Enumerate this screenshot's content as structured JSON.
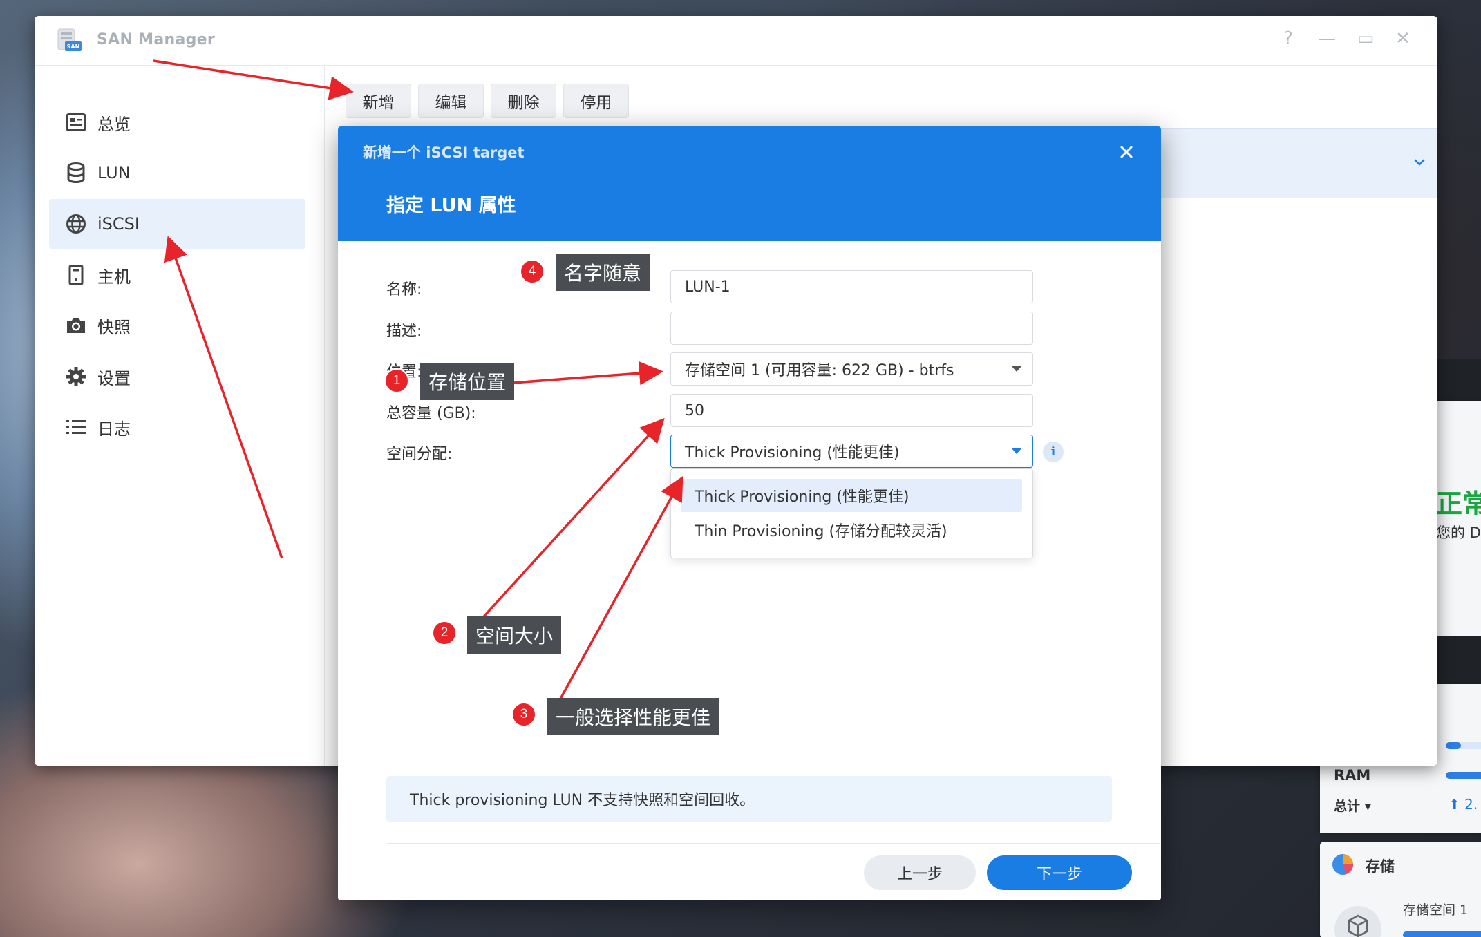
{
  "app": {
    "title": "SAN Manager",
    "logo_text": "SAN",
    "help": "?",
    "minimize": "—",
    "maximize": "▭",
    "close": "✕"
  },
  "sidebar": {
    "items": [
      {
        "label": "总览",
        "icon": "overview-icon"
      },
      {
        "label": "LUN",
        "icon": "database-icon"
      },
      {
        "label": "iSCSI",
        "icon": "globe-icon",
        "active": true
      },
      {
        "label": "主机",
        "icon": "host-icon"
      },
      {
        "label": "快照",
        "icon": "camera-icon"
      },
      {
        "label": "设置",
        "icon": "gear-icon"
      },
      {
        "label": "日志",
        "icon": "list-icon"
      }
    ]
  },
  "toolbar": {
    "add": "新增",
    "edit": "编辑",
    "delete": "删除",
    "disable": "停用"
  },
  "modal": {
    "title": "新增一个 iSCSI target",
    "subtitle": "指定 LUN 属性",
    "fields": {
      "name_label": "名称:",
      "name_value": "LUN-1",
      "desc_label": "描述:",
      "desc_value": "",
      "location_label": "位置:",
      "location_value": "存储空间 1 (可用容量: 622 GB) - btrfs",
      "capacity_label": "总容量 (GB):",
      "capacity_value": "50",
      "alloc_label": "空间分配:",
      "alloc_value": "Thick Provisioning (性能更佳)"
    },
    "alloc_options": [
      "Thick Provisioning (性能更佳)",
      "Thin Provisioning (存储分配较灵活)"
    ],
    "info": "i",
    "notice": "Thick provisioning LUN 不支持快照和空间回收。",
    "prev": "上一步",
    "next": "下一步"
  },
  "annotations": [
    {
      "num": "1",
      "text": "存储位置"
    },
    {
      "num": "2",
      "text": "空间大小"
    },
    {
      "num": "3",
      "text": "一般选择性能更佳"
    },
    {
      "num": "4",
      "text": "名字随意"
    }
  ],
  "widgets": {
    "status_big": "正常",
    "status_small": "您的 D",
    "ram": "RAM",
    "total": "总计 ▾",
    "upload": "⬆ 2.",
    "storage_title": "存储",
    "storage_sub": "存储空间 1"
  },
  "colors": {
    "accent": "#1a7de3",
    "annotation_red": "#e8242b",
    "ok_green": "#1aa640"
  }
}
